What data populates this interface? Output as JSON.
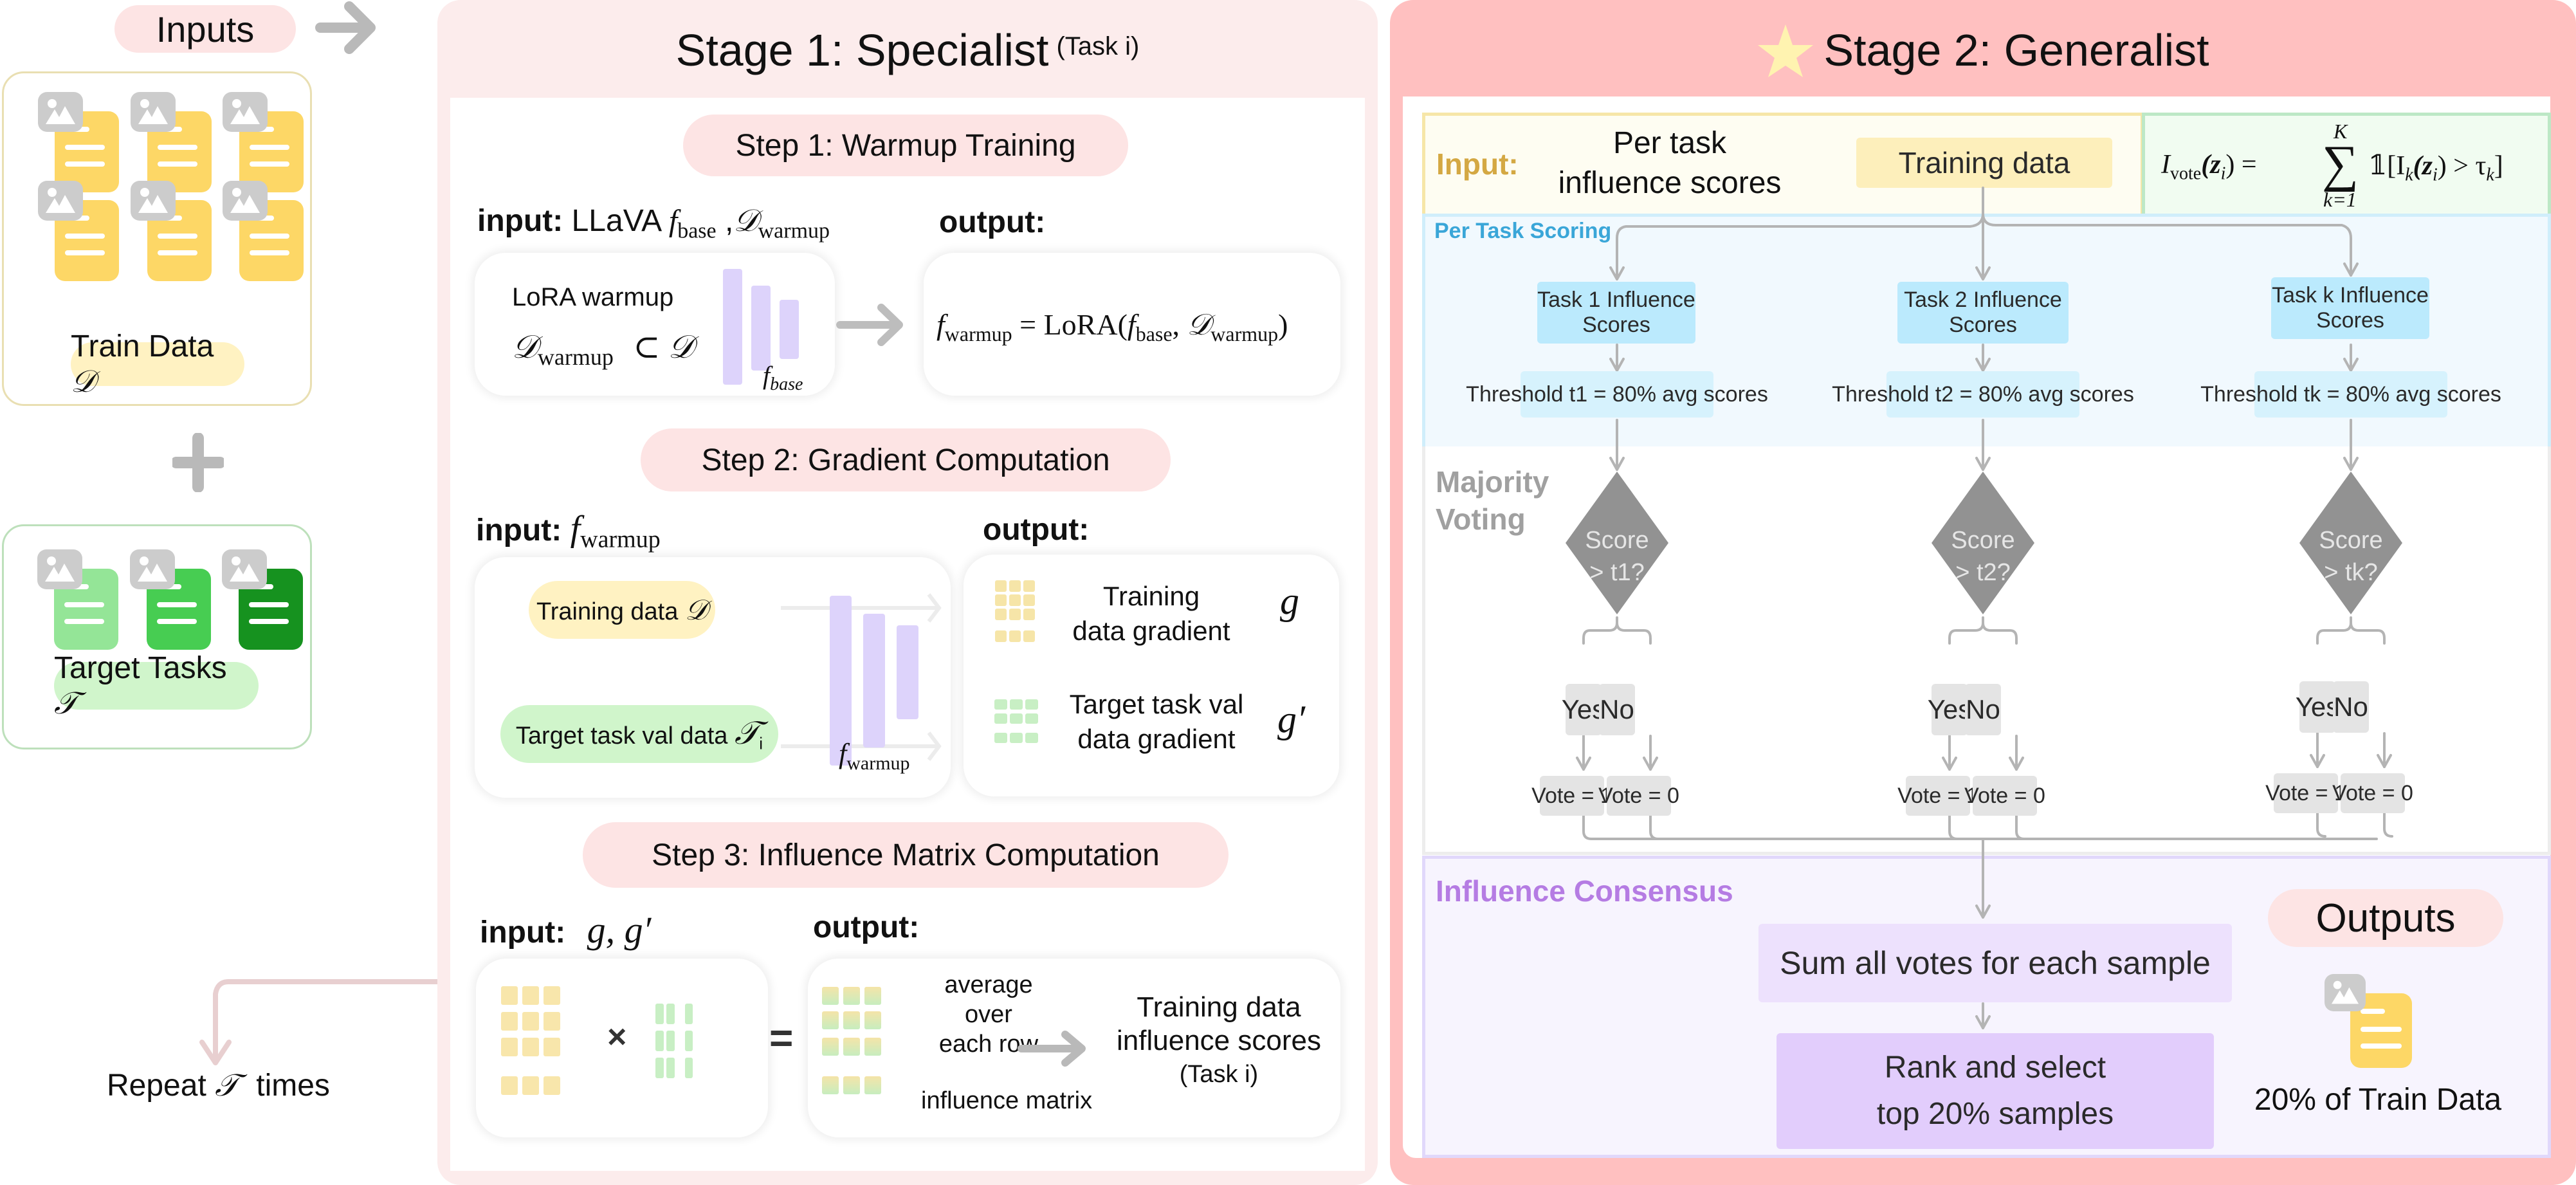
{
  "inputs": {
    "title": "Inputs",
    "train_data_label": "Train Data",
    "train_data_symbol": "𝒟",
    "target_tasks_label": "Target Tasks",
    "target_tasks_symbol": "𝒯",
    "repeat_prefix": "Repeat",
    "repeat_symbol": "𝒯",
    "repeat_suffix": "times",
    "icons": [
      "image-icon",
      "document-icon",
      "plus-icon",
      "arrow-right-icon"
    ]
  },
  "stage1": {
    "title": "Stage 1: Specialist",
    "subtitle": "(Task i)",
    "step1": {
      "title": "Step 1: Warmup Training",
      "input_label": "input:",
      "input_model": "LLaVA",
      "input_f": "f",
      "input_f_sub": "base",
      "input_sep": ",",
      "input_d": "𝒟",
      "input_d_sub": "warmup",
      "box_line1": "LoRA warmup",
      "box_d": "𝒟",
      "box_d_sub": "warmup",
      "box_subset": "⊂",
      "box_d2": "𝒟",
      "model_f": "f",
      "model_sub": "base",
      "output_label": "output:",
      "eq_f": "f",
      "eq_f_sub": "warmup",
      "eq_rhs_1": " = LoRA(",
      "eq_f2": "f",
      "eq_f2_sub": "base",
      "eq_comma": ", ",
      "eq_d": "𝒟",
      "eq_d_sub": "warmup",
      "eq_close": ")"
    },
    "step2": {
      "title": "Step 2: Gradient Computation",
      "input_label": "input:",
      "input_f": "f",
      "input_f_sub": "warmup",
      "train_pill": "Training data",
      "train_symbol": "𝒟",
      "target_pill": "Target task val data",
      "target_symbol": "𝒯",
      "target_sub": "i",
      "model_f": "f",
      "model_sub": "warmup",
      "output_label": "output:",
      "out1_line1": "Training",
      "out1_line2": "data gradient",
      "out1_symbol": "g",
      "out2_line1": "Target task val",
      "out2_line2": "data gradient",
      "out2_symbol": "g′"
    },
    "step3": {
      "title": "Step 3: Influence Matrix Computation",
      "input_label": "input:",
      "input_symbols": "g, g′",
      "output_label": "output:",
      "times": "×",
      "equals": "=",
      "avg_line1": "average over",
      "avg_line2": "each row",
      "matrix_label": "influence matrix",
      "result_line1": "Training data",
      "result_line2": "influence scores",
      "result_line3": "(Task i)"
    }
  },
  "stage2": {
    "title": "Stage 2: Generalist",
    "star_icon": "star-icon",
    "input_label": "Input:",
    "input_text_line1": "Per task",
    "input_text_line2": "influence scores",
    "training_data": "Training data",
    "formula": {
      "lhs": "I",
      "lhs_sub": "vote",
      "arg": "(z",
      "arg_sub": "i",
      "arg_close": ") =",
      "sum": "∑",
      "sum_top": "K",
      "sum_bottom": "k=1",
      "indicator": "𝟙[I",
      "ind_sub": "k",
      "ind_arg": "(z",
      "ind_arg_sub": "i",
      "ind_rest": ") > τ",
      "tau_sub": "k",
      "close": "]"
    },
    "per_task_scoring": {
      "title": "Per Task Scoring",
      "tasks": [
        {
          "scores": "Task 1 Influence Scores",
          "threshold": "Threshold t1 = 80% avg scores"
        },
        {
          "scores": "Task 2 Influence Scores",
          "threshold": "Threshold t2 = 80% avg scores"
        },
        {
          "scores": "Task k Influence Scores",
          "threshold": "Threshold tk = 80% avg scores"
        }
      ]
    },
    "majority_voting": {
      "title_line1": "Majority",
      "title_line2": "Voting",
      "decisions": [
        {
          "line1": "Score",
          "line2": "> t1?",
          "yes": "Yes",
          "no": "No",
          "vote_yes": "Vote = 1",
          "vote_no": "Vote = 0"
        },
        {
          "line1": "Score",
          "line2": "> t2?",
          "yes": "Yes",
          "no": "No",
          "vote_yes": "Vote = 1",
          "vote_no": "Vote = 0"
        },
        {
          "line1": "Score",
          "line2": "> tk?",
          "yes": "Yes",
          "no": "No",
          "vote_yes": "Vote = 1",
          "vote_no": "Vote = 0"
        }
      ]
    },
    "consensus": {
      "title": "Influence Consensus",
      "sum_box": "Sum all votes for each sample",
      "rank_line1": "Rank and select",
      "rank_line2": "top 20% samples"
    },
    "outputs": {
      "title": "Outputs",
      "label": "20% of Train Data"
    }
  },
  "colors": {
    "stage1_bg": "#fcecec",
    "stage2_bg": "#ffc0c0",
    "pill_pink": "#fde4e4",
    "train_yellow": "#fdd766",
    "train_pill": "#fff2c2",
    "green_light": "#94e597",
    "green_mid": "#47cd52",
    "green_dark": "#16921f",
    "target_pill": "#d0f5cb",
    "lavender": "#ddd3fb",
    "per_task_blue": "#bbeafd",
    "scoring_title": "#3aa6d8",
    "consensus_title": "#b57ce3",
    "input_gold": "#d4a843",
    "diamond_gray": "#929292"
  }
}
